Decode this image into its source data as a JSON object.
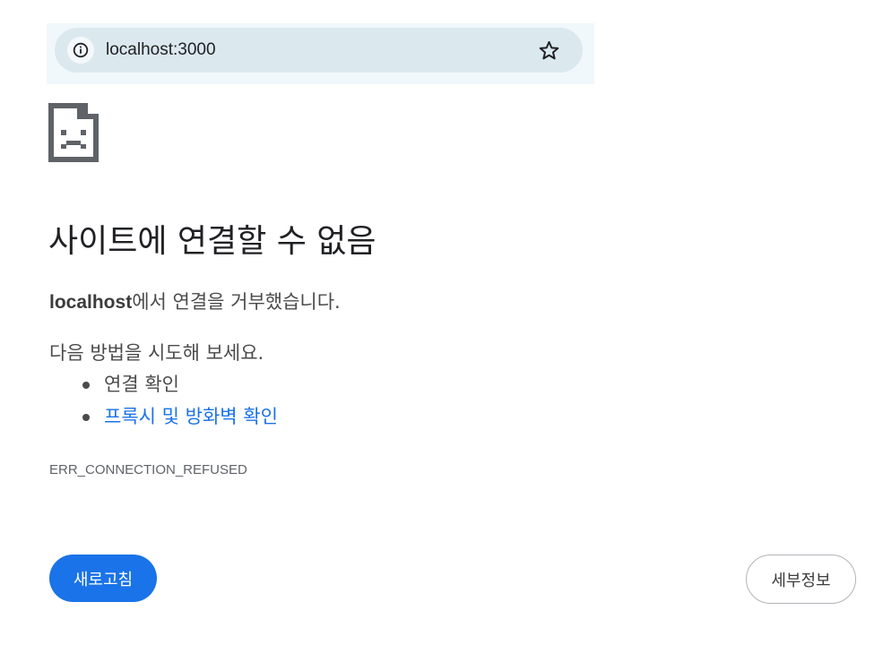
{
  "address_bar": {
    "url": "localhost:3000",
    "info_icon": "info-icon",
    "bookmark_icon": "star-outline-icon"
  },
  "error_page": {
    "icon": "sad-page-icon",
    "heading": "사이트에 연결할 수 없음",
    "host": "localhost",
    "refusal_message": "에서 연결을 거부했습니다.",
    "suggestions_intro": "다음 방법을 시도해 보세요.",
    "suggestions": [
      "연결 확인",
      "프록시 및 방화벽 확인"
    ],
    "error_code": "ERR_CONNECTION_REFUSED",
    "reload_label": "새로고침",
    "details_label": "세부정보"
  },
  "colors": {
    "accent_blue": "#1a73e8",
    "omnibox_bg": "#dbe9ef",
    "strip_bg": "#f1f8fb"
  }
}
